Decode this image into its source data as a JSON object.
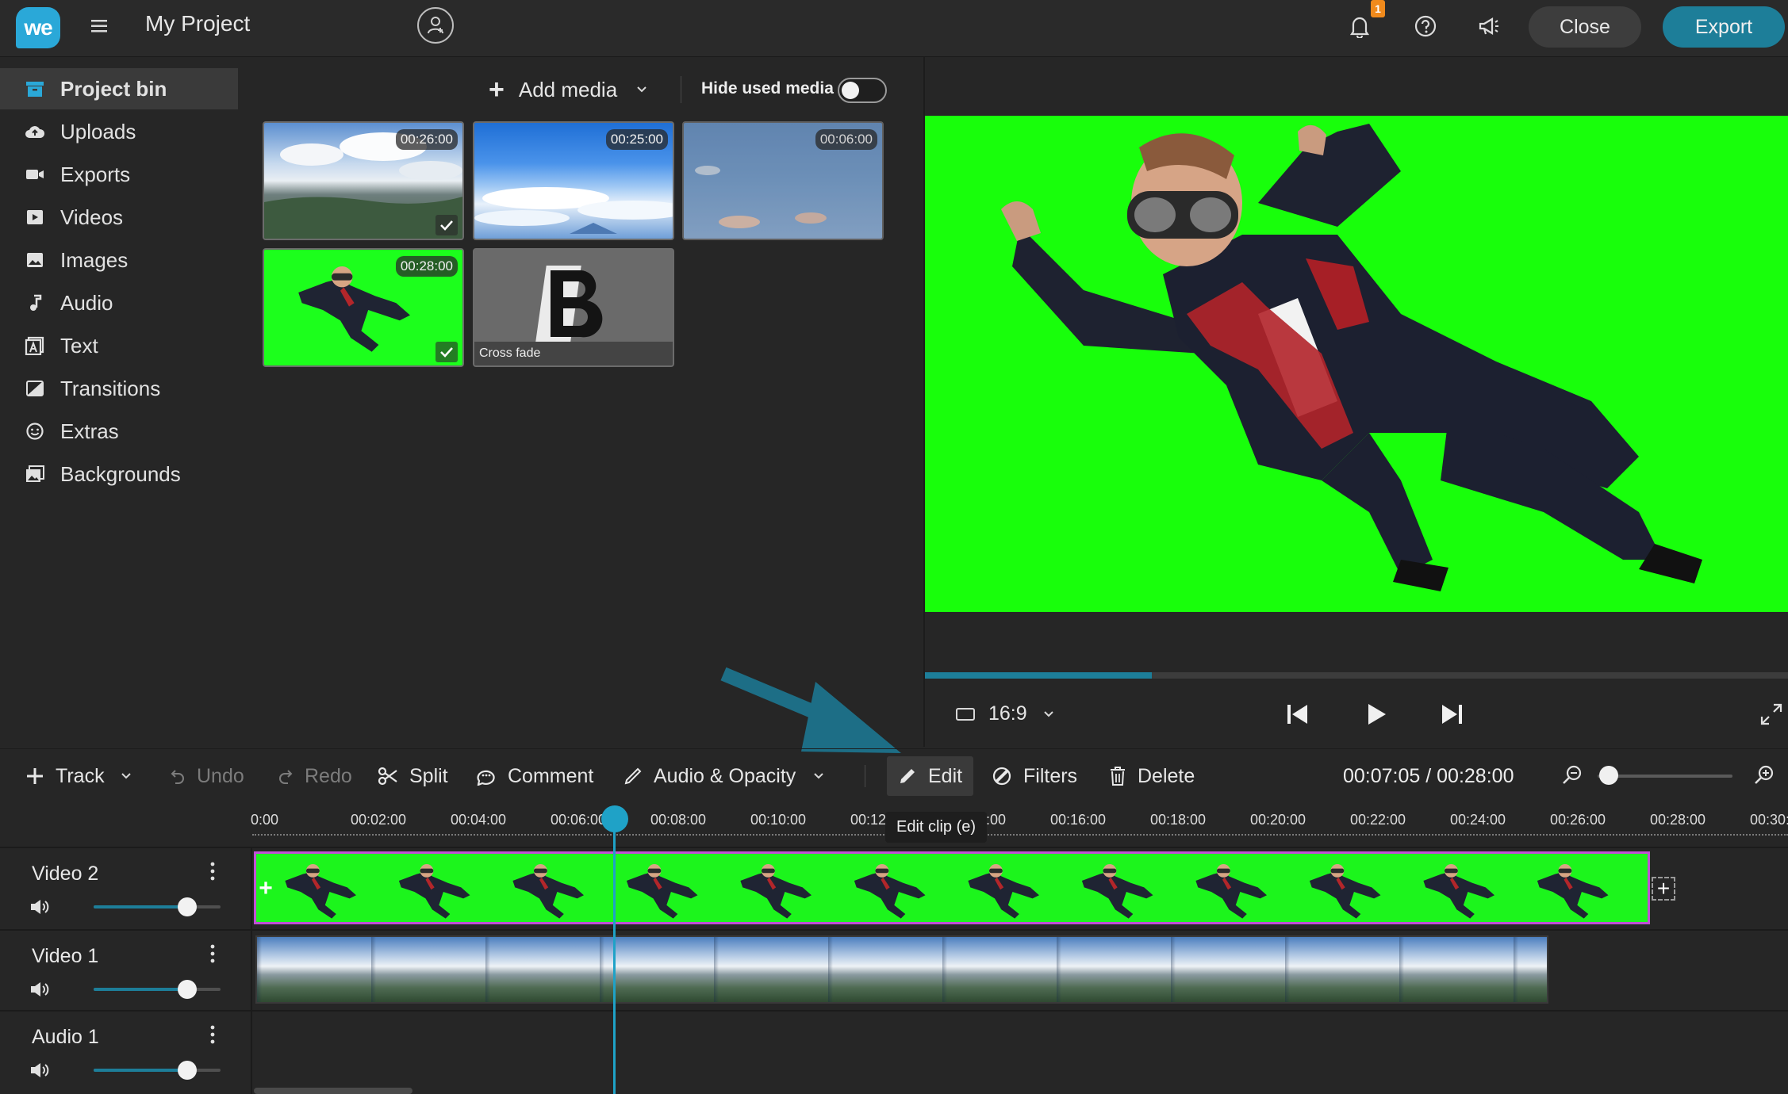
{
  "header": {
    "logo_text": "we",
    "project_title": "My Project",
    "notification_count": "1",
    "close_label": "Close",
    "export_label": "Export"
  },
  "sidebar": {
    "items": [
      {
        "label": "Project bin",
        "icon": "bin-icon",
        "active": true
      },
      {
        "label": "Uploads",
        "icon": "cloud-upload-icon"
      },
      {
        "label": "Exports",
        "icon": "video-camera-icon"
      },
      {
        "label": "Videos",
        "icon": "video-play-icon"
      },
      {
        "label": "Images",
        "icon": "image-icon"
      },
      {
        "label": "Audio",
        "icon": "music-note-icon"
      },
      {
        "label": "Text",
        "icon": "text-icon"
      },
      {
        "label": "Transitions",
        "icon": "transition-icon"
      },
      {
        "label": "Extras",
        "icon": "smiley-icon"
      },
      {
        "label": "Backgrounds",
        "icon": "backgrounds-icon"
      }
    ]
  },
  "media": {
    "add_media_label": "Add media",
    "hide_used_label": "Hide used media",
    "hide_used_on": false,
    "items": [
      {
        "duration": "00:26:00",
        "kind": "sky-landscape",
        "used": true
      },
      {
        "duration": "00:25:00",
        "kind": "blue-sky",
        "used": false
      },
      {
        "duration": "00:06:00",
        "kind": "faded-sky",
        "used": false
      },
      {
        "duration": "00:28:00",
        "kind": "green-screen-skydiver",
        "used": true
      },
      {
        "caption": "Cross fade",
        "kind": "transition"
      }
    ]
  },
  "preview": {
    "aspect_ratio": "16:9",
    "playback_progress": 0.263
  },
  "toolbar": {
    "track_label": "Track",
    "undo_label": "Undo",
    "redo_label": "Redo",
    "split_label": "Split",
    "comment_label": "Comment",
    "audio_opacity_label": "Audio & Opacity",
    "edit_label": "Edit",
    "filters_label": "Filters",
    "delete_label": "Delete",
    "timecode": "00:07:05 / 00:28:00",
    "edit_tooltip": "Edit clip (e)"
  },
  "timeline": {
    "ticks": [
      "0:00",
      "00:02:00",
      "00:04:00",
      "00:06:00",
      "00:08:00",
      "00:10:00",
      "00:12:00",
      "00:14:00",
      "00:16:00",
      "00:18:00",
      "00:20:00",
      "00:22:00",
      "00:24:00",
      "00:26:00",
      "00:28:00",
      "00:30:00"
    ],
    "playhead_time": "00:07:05",
    "tracks": [
      {
        "name": "Video 2",
        "volume": 0.75
      },
      {
        "name": "Video 1",
        "volume": 0.75
      },
      {
        "name": "Audio 1",
        "volume": 0.75
      }
    ]
  },
  "colors": {
    "accent": "#1d7e99",
    "playhead": "#1fa2c7",
    "green_screen": "#18ff0b",
    "selection": "#c04fd6",
    "badge": "#f08a1c"
  }
}
